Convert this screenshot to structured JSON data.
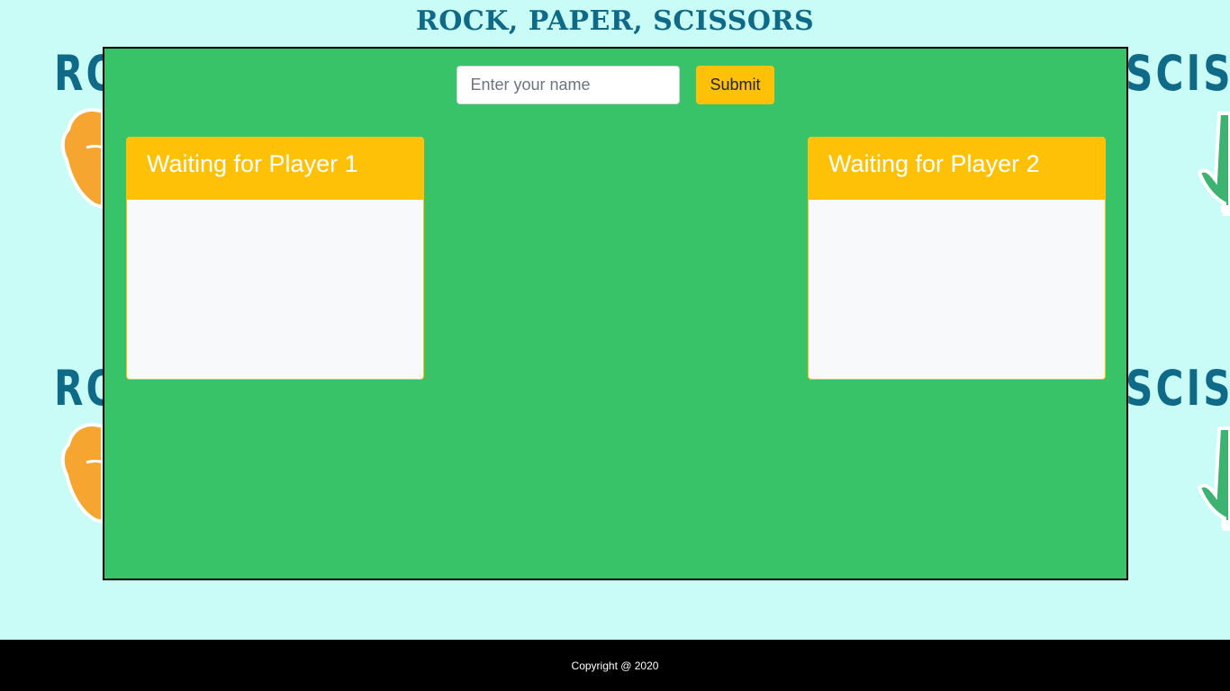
{
  "header": {
    "title": "ROCK, PAPER, SCISSORS"
  },
  "background": {
    "left_word": "RO",
    "right_word": "SCISS",
    "left_art": "boxing-glove-icon",
    "right_art": "peace-hand-icon"
  },
  "form": {
    "name_placeholder": "Enter your name",
    "name_value": "",
    "submit_label": "Submit"
  },
  "players": [
    {
      "status": "Waiting for Player 1"
    },
    {
      "status": "Waiting for Player 2"
    }
  ],
  "footer": {
    "copyright": "Copyright @ 2020"
  },
  "colors": {
    "background": "#cafcf7",
    "board": "#38c368",
    "accent": "#ffc107",
    "title": "#0f6a87",
    "footer": "#000000"
  }
}
